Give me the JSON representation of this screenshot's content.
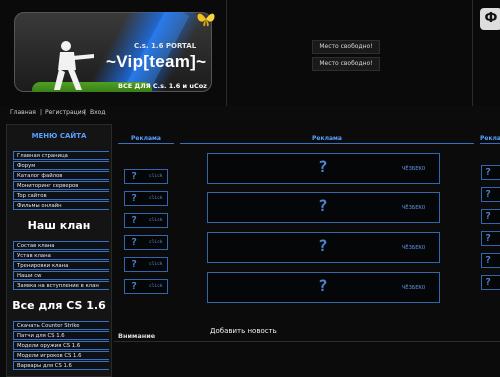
{
  "header": {
    "logo_small": "C.s. 1.6 PORTAL",
    "logo_big": "~Vip[team]~",
    "logo_sub": "ВСЕ ДЛЯ C.s. 1.6 и uCoz",
    "banners": [
      "Место свободно!",
      "Место свободно!"
    ],
    "corner_logo": "Ф"
  },
  "nav": {
    "items": [
      "Главная",
      "Регистрация",
      "Вход"
    ],
    "separator": "|"
  },
  "sidebar": {
    "menu_title": "МЕНЮ САЙТА",
    "menu_items": [
      "Главная страница",
      "Форум",
      "Каталог файлов",
      "Мониторинг серверов",
      "Top сайтов",
      "Фильмы онлайн"
    ],
    "clan_heading": "Наш клан",
    "clan_items": [
      "Состав клана",
      "Устав клана",
      "Тренировки клана",
      "Наши cw",
      "Заявка на вступление в клан"
    ],
    "cs_heading": "Все для CS 1.6",
    "cs_items": [
      "Скачать Counter Strike",
      "Патчи для CS 1.6",
      "Модели оружия CS 1.6",
      "Модели игроков CS 1.6",
      "Варвары для CS 1.6"
    ]
  },
  "main": {
    "left_header": "Реклама",
    "center_header": "Реклама",
    "right_header": "Рекла",
    "small_ad_tag": "click",
    "wide_ad_tag": "ЧЁЗБЕКО",
    "add_news": "Добавить новость",
    "attention": "Внимание"
  },
  "colors": {
    "accent": "#3a6fc0",
    "title_blue": "#5a9fff"
  }
}
